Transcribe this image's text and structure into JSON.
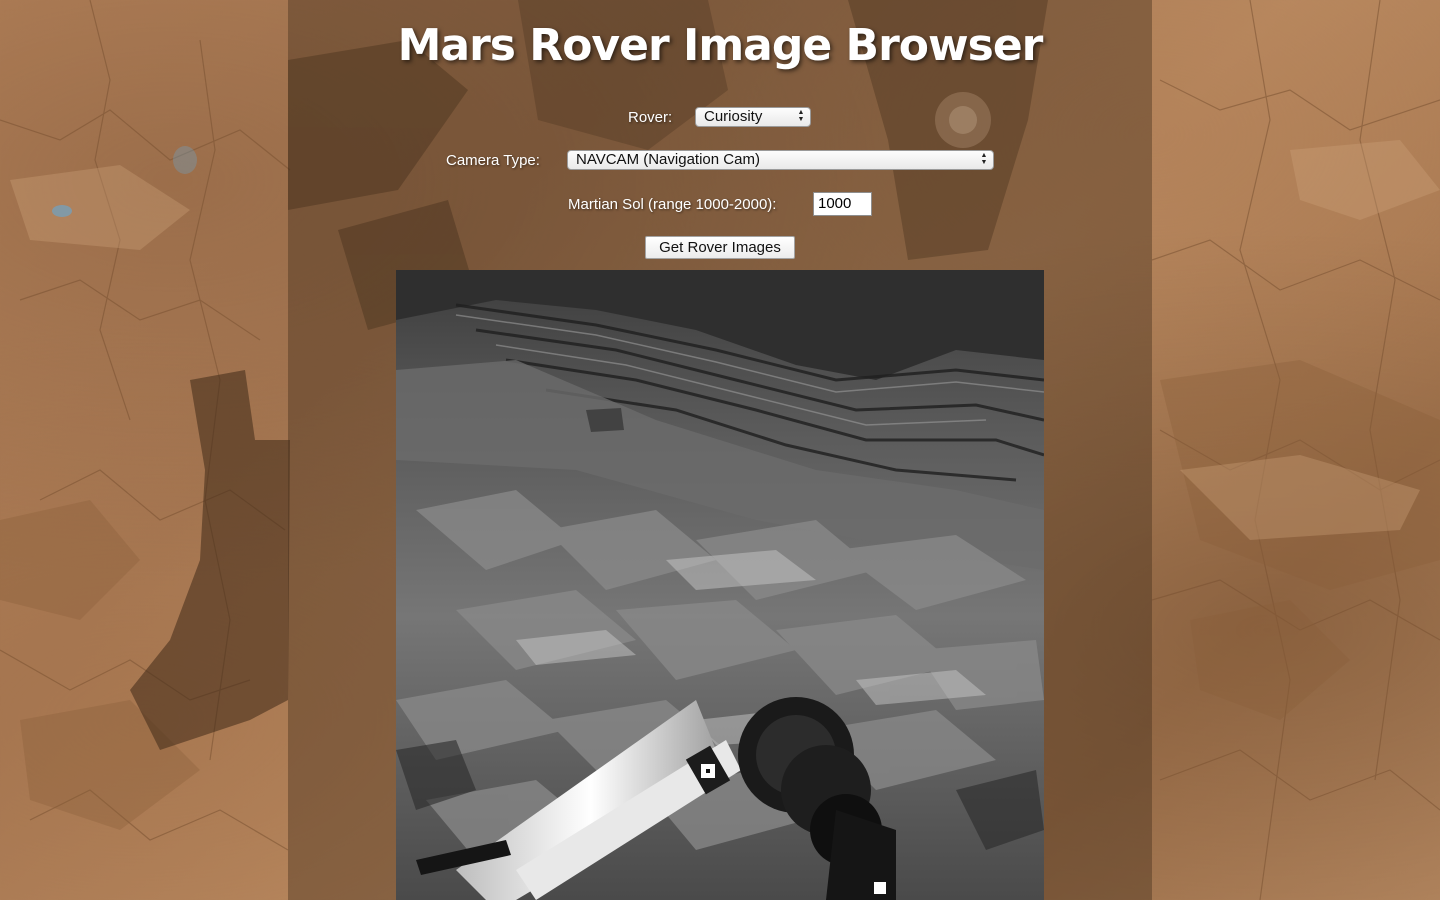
{
  "header": {
    "title": "Mars Rover Image Browser"
  },
  "form": {
    "rover_label": "Rover:",
    "rover_selected": "Curiosity",
    "camera_label": "Camera Type:",
    "camera_selected": "NAVCAM (Navigation Cam)",
    "sol_label": "Martian Sol (range 1000-2000):",
    "sol_value": "1000",
    "submit_label": "Get Rover Images"
  },
  "icons": {
    "select_arrows": "select-arrows-icon"
  },
  "colors": {
    "title": "#ffffff",
    "panel_overlay": "#462f1c",
    "background_mars": "#b4825a"
  }
}
